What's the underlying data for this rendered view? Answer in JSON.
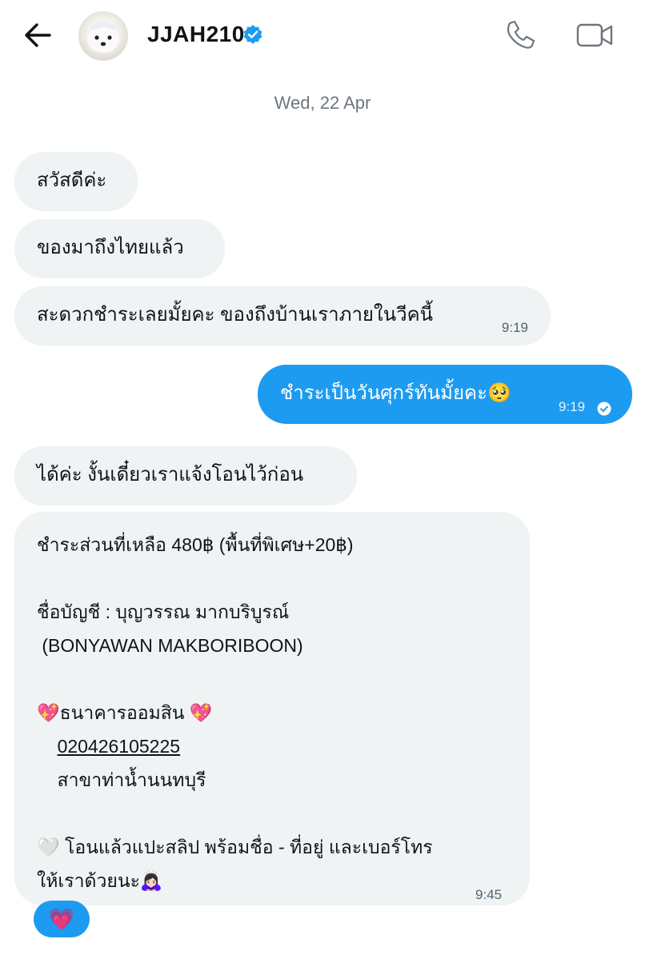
{
  "header": {
    "username": "JJAH210",
    "verified": true
  },
  "conversation": {
    "date_separator": "Wed, 22 Apr",
    "messages": [
      {
        "direction": "in",
        "text": "สวัสดีค่ะ"
      },
      {
        "direction": "in",
        "text": "ของมาถึงไทยแล้ว"
      },
      {
        "direction": "in",
        "text": "สะดวกชำระเลยมั้ยคะ ของถึงบ้านเราภายในวีคนี้",
        "time": "9:19"
      },
      {
        "direction": "out",
        "text": "ชำระเป็นวันศุกร์ทันมั้ยคะ🥺",
        "time": "9:19",
        "status": "seen"
      },
      {
        "direction": "in",
        "text": "ได้ค่ะ งั้นเดี๋ยวเราแจ้งโอนไว้ก่อน"
      },
      {
        "direction": "in",
        "lines": [
          "ชำระส่วนที่เหลือ 480฿ (พื้นที่พิเศษ+20฿)",
          "",
          "ชื่อบัญชี : บุญวรรณ มากบริบูรณ์",
          " (BONYAWAN MAKBORIBOON)",
          "",
          "💖ธนาคารออมสิน 💖",
          "    020426105225",
          "    สาขาท่าน้ำนนทบุรี",
          "",
          "🤍 โอนแล้วแปะสลิป พร้อมชื่อ - ที่อยู่ และเบอร์โทร",
          "ให้เราด้วยนะ🙇🏻‍♀️"
        ],
        "account_number": "020426105225",
        "time": "9:45"
      }
    ],
    "reaction": "💗"
  },
  "colors": {
    "accent": "#1d9bf0",
    "incoming_bubble": "#eff3f4",
    "muted_text": "#6e767d"
  },
  "icons": [
    "back-arrow-icon",
    "verified-badge-icon",
    "phone-icon",
    "video-call-icon",
    "seen-check-icon"
  ]
}
